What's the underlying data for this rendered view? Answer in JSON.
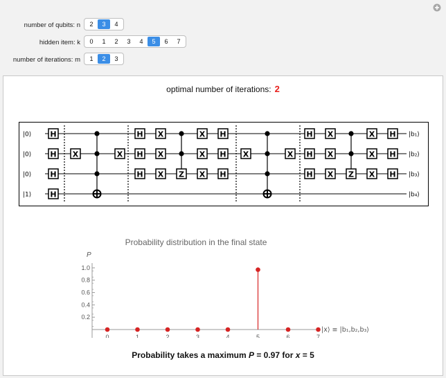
{
  "controls": {
    "qubits": {
      "label": "number of qubits: n",
      "options": [
        "2",
        "3",
        "4"
      ],
      "selected": "3"
    },
    "hidden_item": {
      "label": "hidden item: k",
      "options": [
        "0",
        "1",
        "2",
        "3",
        "4",
        "5",
        "6",
        "7"
      ],
      "selected": "5"
    },
    "iterations": {
      "label": "number of iterations: m",
      "options": [
        "1",
        "2",
        "3"
      ],
      "selected": "2"
    }
  },
  "optimal": {
    "label": "optimal number of iterations:",
    "value": "2"
  },
  "circuit": {
    "inputs": [
      "|0⟩",
      "|0⟩",
      "|0⟩",
      "|1⟩"
    ],
    "outputs": [
      "|b₁⟩",
      "|b₂⟩",
      "|b₃⟩",
      "|b₄⟩"
    ],
    "gates": {
      "h": "H",
      "x": "X",
      "z": "Z"
    }
  },
  "chart_data": {
    "type": "scatter",
    "title": "Probability distribution in the final state",
    "ylabel": "P",
    "xlabel": "|x⟩ ≡ |b₁,b₂,b₃⟩",
    "x": [
      0,
      1,
      2,
      3,
      4,
      5,
      6,
      7
    ],
    "values": [
      0.0,
      0.0,
      0.0,
      0.0,
      0.0,
      0.97,
      0.0,
      0.0
    ],
    "ylim": [
      0,
      1.1
    ],
    "yticks": [
      "0.2",
      "0.4",
      "0.6",
      "0.8",
      "1.0"
    ],
    "xticks": [
      "0",
      "1",
      "2",
      "3",
      "4",
      "5",
      "6",
      "7"
    ],
    "color": "#d62424"
  },
  "result": {
    "prefix": "Probability takes a maximum ",
    "p": "P",
    "eq1": " = 0.97 for ",
    "x": "x",
    "eq2": " = 5"
  },
  "icons": {
    "plus": "plus-icon"
  }
}
